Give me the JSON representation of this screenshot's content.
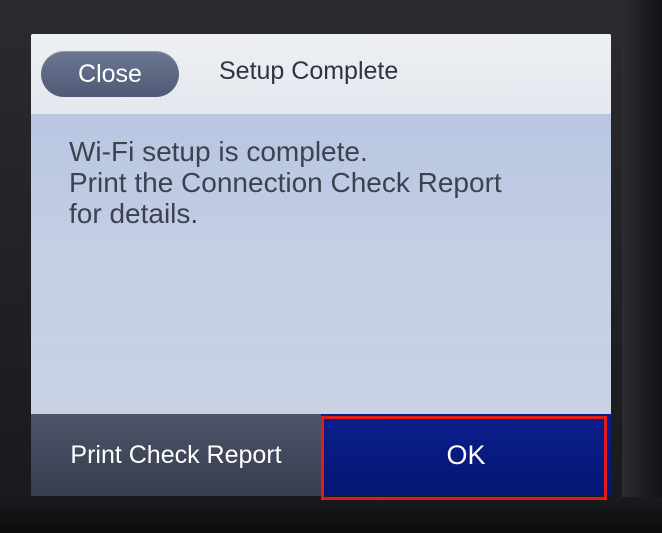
{
  "header": {
    "close_label": "Close",
    "title": "Setup Complete"
  },
  "message": {
    "line1": "Wi-Fi setup is complete.",
    "line2": "Print the Connection Check Report",
    "line3": "for details."
  },
  "footer": {
    "report_label": "Print Check Report",
    "ok_label": "OK"
  },
  "colors": {
    "highlight": "#e41b1b",
    "ok_button": "#0b1f8c",
    "close_button": "#5c6883"
  }
}
